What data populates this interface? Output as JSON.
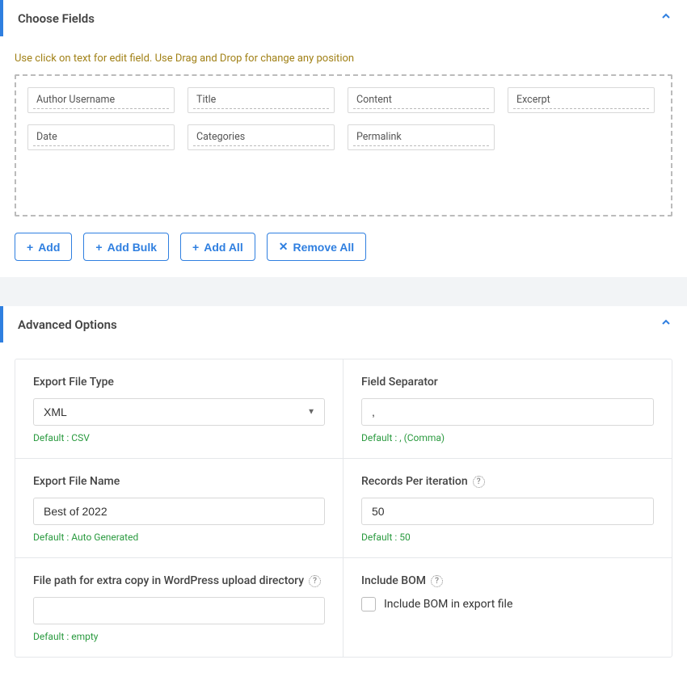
{
  "choose_fields": {
    "title": "Choose Fields",
    "helper": "Use click on text for edit field. Use Drag and Drop for change any position",
    "fields": [
      "Author Username",
      "Title",
      "Content",
      "Excerpt",
      "Date",
      "Categories",
      "Permalink"
    ],
    "buttons": {
      "add": "Add",
      "add_bulk": "Add Bulk",
      "add_all": "Add All",
      "remove_all": "Remove All"
    }
  },
  "advanced": {
    "title": "Advanced Options",
    "export_file_type": {
      "label": "Export File Type",
      "value": "XML",
      "default": "Default : CSV"
    },
    "field_separator": {
      "label": "Field Separator",
      "value": ",",
      "default": "Default : , (Comma)"
    },
    "export_file_name": {
      "label": "Export File Name",
      "value": "Best of 2022",
      "default": "Default : Auto Generated"
    },
    "records_per_iteration": {
      "label": "Records Per iteration",
      "value": "50",
      "default": "Default : 50"
    },
    "file_path": {
      "label": "File path for extra copy in WordPress upload directory",
      "value": "",
      "default": "Default : empty"
    },
    "include_bom": {
      "label": "Include BOM",
      "checkbox_label": "Include BOM in export file"
    }
  }
}
